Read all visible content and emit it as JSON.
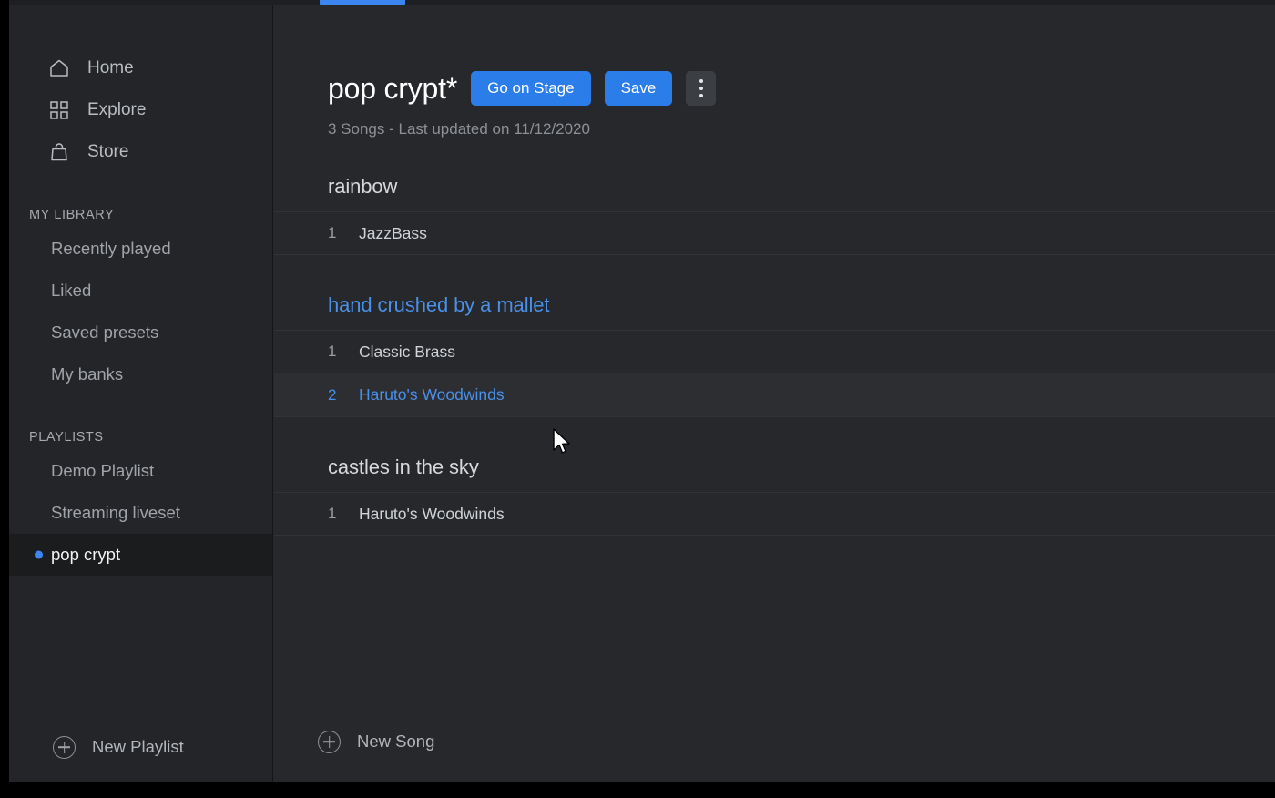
{
  "window": {
    "accent_color": "#3b86f0",
    "background_color": "#26282b",
    "sidebar_color": "#232528"
  },
  "sidebar": {
    "nav": [
      {
        "label": "Home",
        "icon": "home-icon"
      },
      {
        "label": "Explore",
        "icon": "grid-icon"
      },
      {
        "label": "Store",
        "icon": "bag-icon"
      }
    ],
    "library": {
      "label": "MY LIBRARY",
      "items": [
        {
          "label": "Recently played"
        },
        {
          "label": "Liked"
        },
        {
          "label": "Saved presets"
        },
        {
          "label": "My banks"
        }
      ]
    },
    "playlists": {
      "label": "PLAYLISTS",
      "items": [
        {
          "label": "Demo Playlist",
          "active": false
        },
        {
          "label": "Streaming liveset",
          "active": false
        },
        {
          "label": "pop crypt",
          "active": true
        }
      ]
    },
    "new_playlist_label": "New Playlist",
    "new_playlist_icon": "plus-circle-icon"
  },
  "main": {
    "title": "pop crypt*",
    "go_on_stage_label": "Go on Stage",
    "save_label": "Save",
    "more_menu_icon": "kebab-menu-icon",
    "subtitle": "3 Songs - Last updated on 11/12/2020",
    "songs": [
      {
        "title": "rainbow",
        "current": false,
        "tracks": [
          {
            "index": "1",
            "name": "JazzBass",
            "selected": false
          }
        ]
      },
      {
        "title": "hand crushed by a mallet",
        "current": true,
        "tracks": [
          {
            "index": "1",
            "name": "Classic Brass",
            "selected": false
          },
          {
            "index": "2",
            "name": "Haruto's Woodwinds",
            "selected": true
          }
        ]
      },
      {
        "title": "castles in the sky",
        "current": false,
        "tracks": [
          {
            "index": "1",
            "name": "Haruto's Woodwinds",
            "selected": false
          }
        ]
      }
    ],
    "new_song_label": "New Song",
    "new_song_icon": "plus-circle-icon"
  }
}
